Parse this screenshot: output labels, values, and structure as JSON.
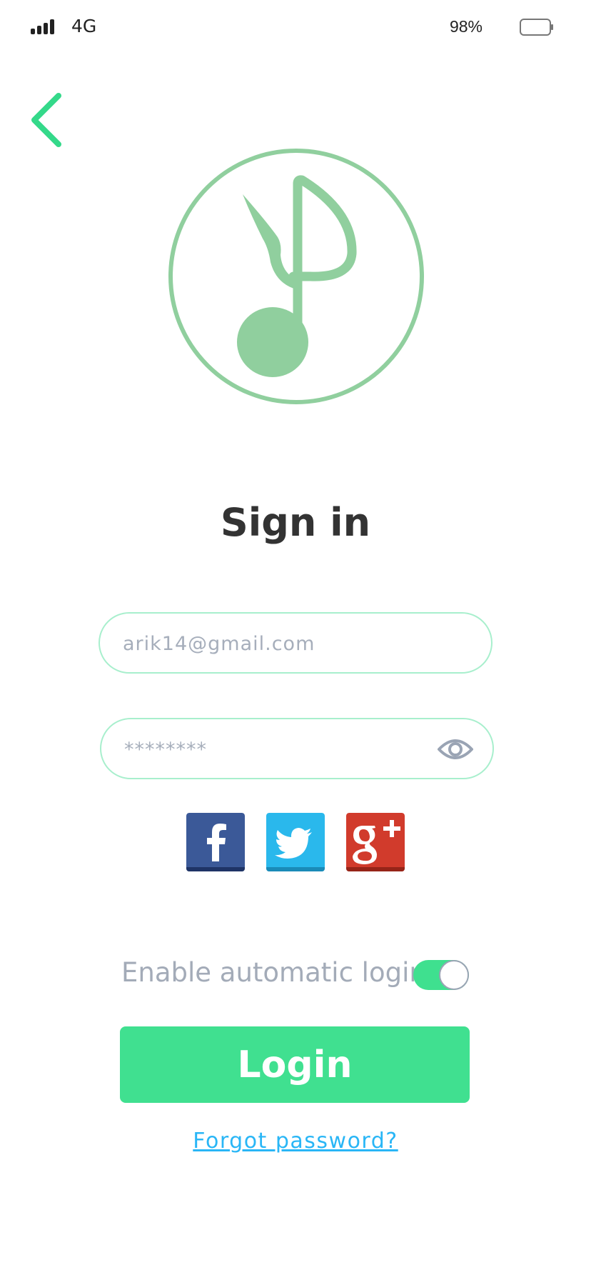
{
  "status_bar": {
    "network": "4G",
    "battery_percent": "98%"
  },
  "icons": {
    "back": "chevron-left-icon",
    "logo": "music-note-icon",
    "visibility": "eye-icon",
    "facebook": "facebook-icon",
    "twitter": "twitter-icon",
    "google_plus": "google-plus-icon"
  },
  "title": "Sign in",
  "form": {
    "email_placeholder": "arik14@gmail.com",
    "password_placeholder": "********"
  },
  "auto_login": {
    "label": "Enable automatic login",
    "enabled": true
  },
  "login_label": "Login",
  "forgot_password_label": "Forgot password?",
  "colors": {
    "accent": "#40e090",
    "logo": "#90cf9e",
    "back_arrow": "#34d98a",
    "link": "#29b6f6",
    "facebook": "#3b5998",
    "twitter": "#2ab8ec",
    "google_plus": "#d13b2c"
  }
}
